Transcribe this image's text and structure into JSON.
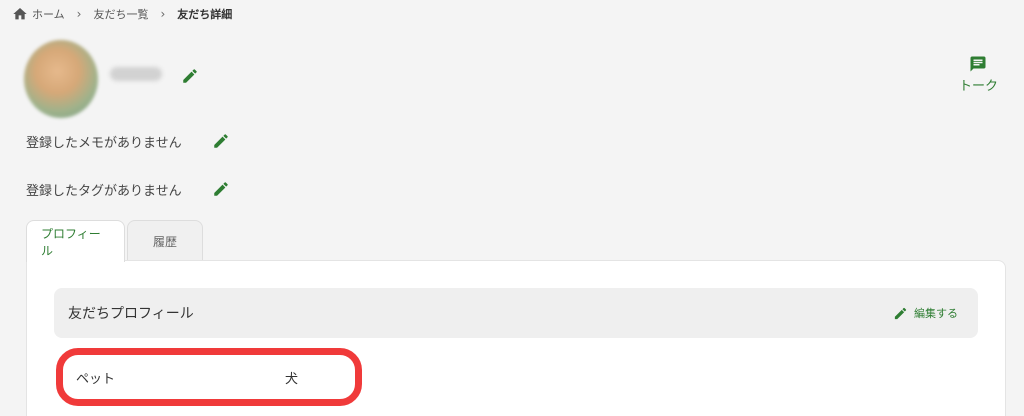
{
  "breadcrumb": {
    "home": "ホーム",
    "friends_list": "友だち一覧",
    "current": "友だち詳細"
  },
  "header": {
    "talk_label": "トーク"
  },
  "memo": {
    "empty_text": "登録したメモがありません"
  },
  "tags": {
    "empty_text": "登録したタグがありません"
  },
  "tabs": [
    {
      "label": "プロフィール",
      "active": true
    },
    {
      "label": "履歴",
      "active": false
    }
  ],
  "profile": {
    "title": "友だちプロフィール",
    "edit_label": "編集する",
    "fields": [
      {
        "label": "ペット",
        "value": "犬"
      }
    ]
  },
  "colors": {
    "accent": "#2e7d32",
    "highlight": "#f03a3a"
  }
}
